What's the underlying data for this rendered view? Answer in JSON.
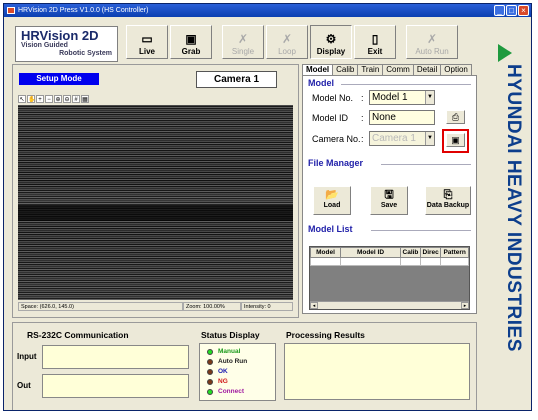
{
  "window": {
    "title": "HRVision 2D Press V1.0.0 (HS Controller)",
    "controls": [
      "_",
      "□",
      "×"
    ]
  },
  "logo": {
    "title": "HRVision 2D",
    "line1": "Vision Guided",
    "line2": "Robotic System"
  },
  "toolbar": [
    {
      "label": "Live",
      "icon": "camera-icon",
      "glyph": "▭",
      "enabled": true
    },
    {
      "label": "Grab",
      "icon": "grab-camera-icon",
      "glyph": "▣",
      "enabled": true
    },
    {
      "label": "Single",
      "icon": "single-run-icon",
      "glyph": "✗",
      "enabled": false
    },
    {
      "label": "Loop",
      "icon": "loop-run-icon",
      "glyph": "✗",
      "enabled": false
    },
    {
      "label": "Display",
      "icon": "display-icon",
      "glyph": "⚙",
      "enabled": true
    },
    {
      "label": "Exit",
      "icon": "exit-door-icon",
      "glyph": "▯",
      "enabled": true
    },
    {
      "label": "Auto Run",
      "icon": "auto-run-icon",
      "glyph": "✗",
      "enabled": false
    }
  ],
  "left": {
    "mode_label": "Setup Mode",
    "camera_label": "Camera 1",
    "status": {
      "space": "Space: (626.0, 145.0)",
      "zoom": "Zoom: 100.00%",
      "intensity": "Intensity: 0"
    }
  },
  "tabs": [
    "Model",
    "Calib",
    "Train",
    "Comm",
    "Detail",
    "Option"
  ],
  "model": {
    "section": "Model",
    "model_no_label": "Model No.",
    "model_no_value": "Model 1",
    "model_id_label": "Model ID",
    "model_id_value": "None",
    "camera_no_label": "Camera No.",
    "camera_no_value": "Camera 1"
  },
  "file_manager": {
    "section": "File Manager",
    "load": "Load",
    "save": "Save",
    "backup": "Data Backup"
  },
  "model_list": {
    "section": "Model List",
    "columns": [
      "Model",
      "Model ID",
      "Calib",
      "Direc",
      "Pattern"
    ]
  },
  "bottom": {
    "rs232_title": "RS-232C Communication",
    "input_label": "Input",
    "out_label": "Out",
    "status_title": "Status Display",
    "statuses": [
      {
        "label": "Manual",
        "color": "#1a9a1a",
        "led": "#22dd22"
      },
      {
        "label": "Auto Run",
        "color": "#222222",
        "led": "#7a3a1a"
      },
      {
        "label": "OK",
        "color": "#1a1ab0",
        "led": "#7a3a1a"
      },
      {
        "label": "NG",
        "color": "#d01a1a",
        "led": "#7a3a1a"
      },
      {
        "label": "Connect",
        "color": "#a01aa0",
        "led": "#22dd22"
      }
    ],
    "results_title": "Processing Results"
  },
  "brand": {
    "text": "HYUNDAI HEAVY INDUSTRIES",
    "green": "#1f9a3e",
    "blue": "#0d3e8c"
  }
}
